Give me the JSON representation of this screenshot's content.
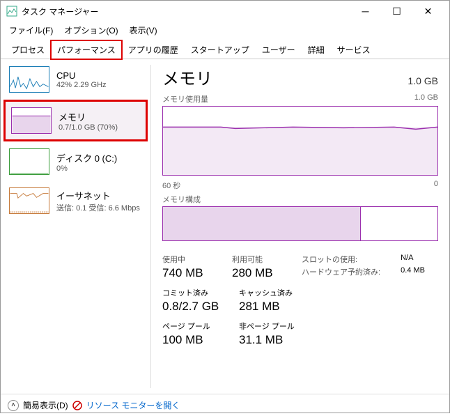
{
  "window": {
    "title": "タスク マネージャー"
  },
  "menu": {
    "file": "ファイル(F)",
    "options": "オプション(O)",
    "view": "表示(V)"
  },
  "tabs": {
    "processes": "プロセス",
    "performance": "パフォーマンス",
    "history": "アプリの履歴",
    "startup": "スタートアップ",
    "users": "ユーザー",
    "details": "詳細",
    "services": "サービス"
  },
  "side": {
    "cpu": {
      "label": "CPU",
      "sub": "42%  2.29 GHz"
    },
    "mem": {
      "label": "メモリ",
      "sub": "0.7/1.0 GB (70%)"
    },
    "disk": {
      "label": "ディスク 0 (C:)",
      "sub": "0%"
    },
    "net": {
      "label": "イーサネット",
      "sub": "送信: 0.1 受信: 6.6 Mbps"
    }
  },
  "main": {
    "title": "メモリ",
    "total": "1.0 GB",
    "usage_label": "メモリ使用量",
    "usage_max": "1.0 GB",
    "axis_left": "60 秒",
    "axis_right": "0",
    "comp_label": "メモリ構成",
    "stats": {
      "inuse_l": "使用中",
      "inuse_v": "740 MB",
      "avail_l": "利用可能",
      "avail_v": "280 MB",
      "slot_l": "スロットの使用:",
      "slot_v": "N/A",
      "hw_l": "ハードウェア予約済み:",
      "hw_v": "0.4 MB",
      "commit_l": "コミット済み",
      "commit_v": "0.8/2.7 GB",
      "cache_l": "キャッシュ済み",
      "cache_v": "281 MB",
      "pp_l": "ページ プール",
      "pp_v": "100 MB",
      "npp_l": "非ページ プール",
      "npp_v": "31.1 MB"
    }
  },
  "footer": {
    "fewer": "簡易表示(D)",
    "resmon": "リソース モニターを開く"
  },
  "chart_data": {
    "type": "line",
    "title": "メモリ使用量",
    "ylabel": "GB",
    "ylim": [
      0,
      1.0
    ],
    "xlabel": "秒",
    "xlim": [
      60,
      0
    ],
    "series": [
      {
        "name": "メモリ",
        "value_approx": 0.7,
        "flat": true
      }
    ],
    "composition": {
      "in_use_fraction": 0.72
    }
  }
}
